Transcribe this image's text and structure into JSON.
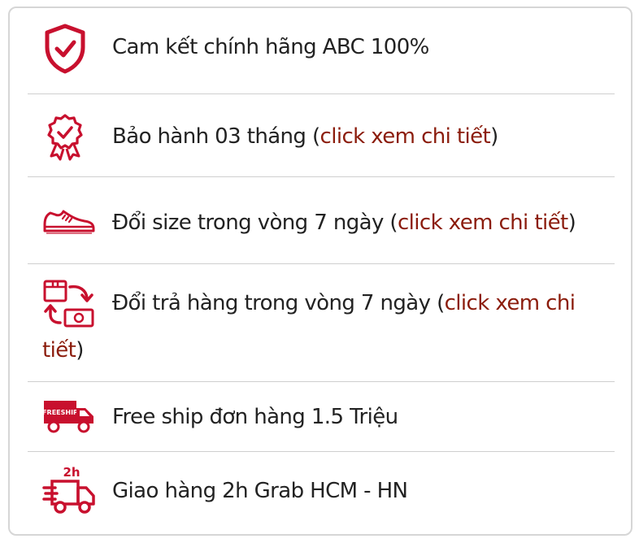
{
  "accent_color": "#c8102e",
  "link_color": "#8b1c0c",
  "items": [
    {
      "icon": "shield-check-icon",
      "text": "Cam kết chính hãng ABC 100%"
    },
    {
      "icon": "award-badge-icon",
      "text_before": "Bảo hành 03 tháng (",
      "link": "click xem chi tiết",
      "text_after": ")"
    },
    {
      "icon": "sneaker-icon",
      "text_before": "Đổi size trong vòng 7 ngày (",
      "link": "click xem chi tiết",
      "text_after": ")"
    },
    {
      "icon": "return-exchange-icon",
      "text_before": "Đổi trả hàng trong vòng 7 ngày (",
      "link": "click xem chi",
      "link_cont": "tiết",
      "text_after": ")"
    },
    {
      "icon": "freeship-truck-icon",
      "text": "Free ship đơn hàng 1.5 Triệu",
      "icon_label": "FREESHIP"
    },
    {
      "icon": "fast-delivery-truck-icon",
      "text": "Giao hàng 2h Grab HCM - HN",
      "icon_label": "2h"
    }
  ]
}
